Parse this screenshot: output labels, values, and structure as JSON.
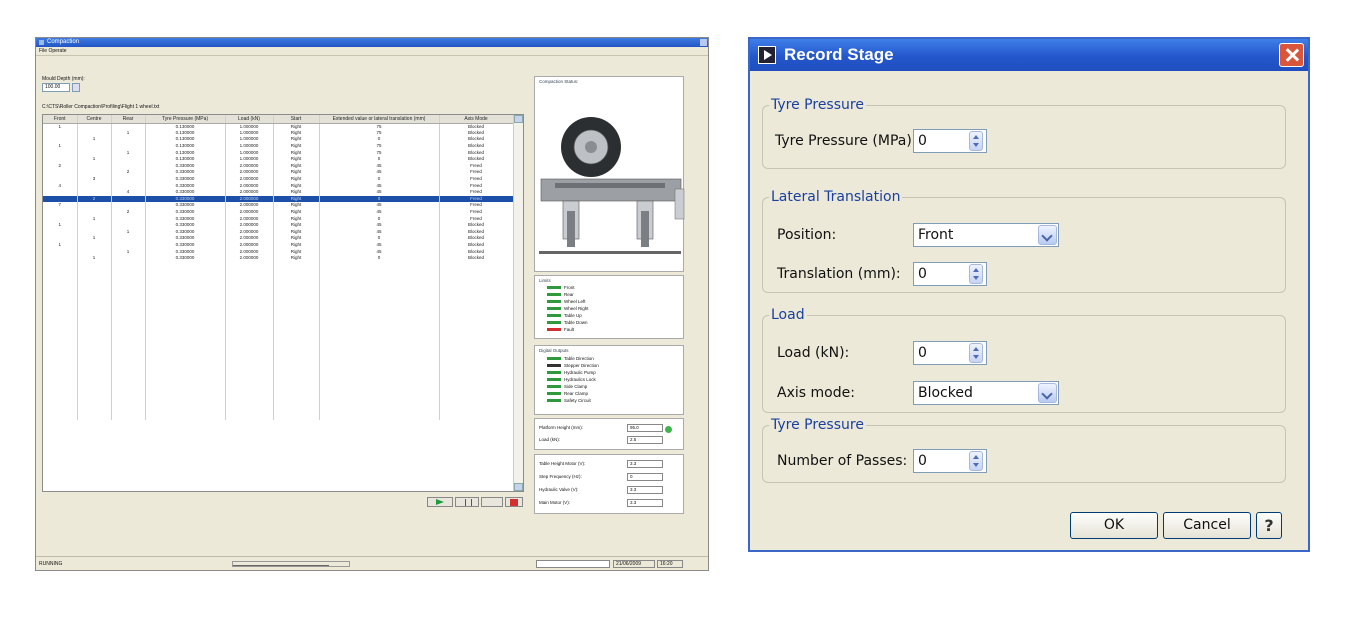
{
  "left_window": {
    "title": "Compaction",
    "menu": "File  Operate",
    "mould_depth_label": "Mould Depth (mm):",
    "mould_depth_value": "100.00",
    "file_path": "C:\\CTS\\Roller Compaction\\Profiling\\Flight 1 wheel.txt",
    "columns": [
      "Front",
      "Centre",
      "Rear",
      "Tyre Pressure (MPa)",
      "Load (kN)",
      "Start",
      "Extended value or lateral translation (mm)",
      "Axis Mode"
    ],
    "rows": [
      [
        "1",
        "",
        "",
        "0.130000",
        "1.000000",
        "Right",
        "75",
        "Blocked"
      ],
      [
        "",
        "",
        "1",
        "0.130000",
        "1.000000",
        "Right",
        "75",
        "Blocked"
      ],
      [
        "",
        "1",
        "",
        "0.130000",
        "1.000000",
        "Right",
        "0",
        "Blocked"
      ],
      [
        "1",
        "",
        "",
        "0.130000",
        "1.000000",
        "Right",
        "75",
        "Blocked"
      ],
      [
        "",
        "",
        "1",
        "0.130000",
        "1.000000",
        "Right",
        "75",
        "Blocked"
      ],
      [
        "",
        "1",
        "",
        "0.130000",
        "1.000000",
        "Right",
        "0",
        "Blocked"
      ],
      [
        "2",
        "",
        "",
        "0.330000",
        "2.000000",
        "Right",
        "45",
        "Freed"
      ],
      [
        "",
        "",
        "2",
        "0.330000",
        "2.000000",
        "Right",
        "45",
        "Freed"
      ],
      [
        "",
        "3",
        "",
        "0.330000",
        "2.000000",
        "Right",
        "0",
        "Freed"
      ],
      [
        "4",
        "",
        "",
        "0.330000",
        "2.000000",
        "Right",
        "45",
        "Freed"
      ],
      [
        "",
        "",
        "4",
        "0.330000",
        "2.000000",
        "Right",
        "45",
        "Freed"
      ],
      [
        "",
        "2",
        "",
        "0.330000",
        "2.000000",
        "Right",
        "0",
        "Freed"
      ],
      [
        "7",
        "",
        "",
        "0.330000",
        "2.000000",
        "Right",
        "45",
        "Freed"
      ],
      [
        "",
        "",
        "2",
        "0.330000",
        "2.000000",
        "Right",
        "45",
        "Freed"
      ],
      [
        "",
        "1",
        "",
        "0.330000",
        "2.000000",
        "Right",
        "0",
        "Freed"
      ],
      [
        "1",
        "",
        "",
        "0.330000",
        "2.000000",
        "Right",
        "45",
        "Blocked"
      ],
      [
        "",
        "",
        "1",
        "0.330000",
        "2.000000",
        "Right",
        "45",
        "Blocked"
      ],
      [
        "",
        "1",
        "",
        "0.330000",
        "2.000000",
        "Right",
        "0",
        "Blocked"
      ],
      [
        "1",
        "",
        "",
        "0.330000",
        "2.000000",
        "Right",
        "45",
        "Blocked"
      ],
      [
        "",
        "",
        "1",
        "0.330000",
        "2.000000",
        "Right",
        "45",
        "Blocked"
      ],
      [
        "",
        "1",
        "",
        "0.330000",
        "2.000000",
        "Right",
        "0",
        "Blocked"
      ]
    ],
    "compaction_status_label": "Compaction Status:",
    "limits_label": "Limits",
    "limits": [
      "Front",
      "Rear",
      "Wheel Left",
      "Wheel Right",
      "Table Up",
      "Table Down",
      "Fault"
    ],
    "digital_outputs_label": "Digital Outputs",
    "digital_outputs": [
      "Table Direction",
      "Stepper Direction",
      "Hydraulic Pump",
      "Hydraulics Lock",
      "Side Clamp",
      "Rear Clamp",
      "Safety Circuit"
    ],
    "measurements": [
      {
        "label": "Platform Height (mm):",
        "value": "95.0"
      },
      {
        "label": "Load (kN):",
        "value": "2.5"
      }
    ],
    "drive": [
      {
        "label": "Table Height Motor (V):",
        "value": "3.3"
      },
      {
        "label": "Step Frequency (Hz):",
        "value": "0"
      },
      {
        "label": "Hydraulic Valve (V):",
        "value": "3.3"
      },
      {
        "label": "Main Motor (V):",
        "value": "3.3"
      }
    ],
    "status_left": "RUNNING",
    "status_date": "21/06/2009",
    "status_time": "16:20",
    "colors": {
      "led_green": "#3eb54a",
      "led_red": "#d23030",
      "selected_row": "#1c4fa8"
    }
  },
  "dialog": {
    "title": "Record Stage",
    "sections": {
      "tyre_pressure": {
        "legend": "Tyre Pressure",
        "label": "Tyre Pressure (MPa):",
        "value": "0"
      },
      "lateral": {
        "legend": "Lateral Translation",
        "position_label": "Position:",
        "position_value": "Front",
        "translation_label": "Translation (mm):",
        "translation_value": "0"
      },
      "load": {
        "legend": "Load",
        "load_label": "Load (kN):",
        "load_value": "0",
        "axis_label": "Axis mode:",
        "axis_value": "Blocked"
      },
      "passes": {
        "legend": "Tyre Pressure",
        "label": "Number of Passes:",
        "value": "0"
      }
    },
    "ok_label": "OK",
    "cancel_label": "Cancel",
    "help_label": "?",
    "colors": {
      "title_bar": "#2456cc",
      "legend_text": "#1a40a0",
      "close_button": "#d9563a"
    }
  }
}
